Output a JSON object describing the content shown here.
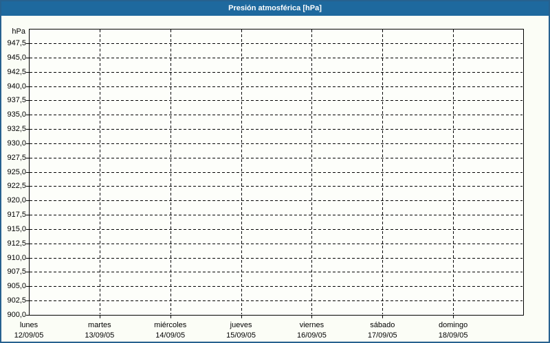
{
  "header": {
    "title": "Presión atmosférica [hPa]"
  },
  "chart_data": {
    "type": "line",
    "title": "Presión atmosférica [hPa]",
    "ylabel": "hPa",
    "ylim": [
      900.0,
      947.5
    ],
    "ytick_step": 2.5,
    "ytick_labels": [
      "947,5",
      "945,0",
      "942,5",
      "940,0",
      "937,5",
      "935,0",
      "932,5",
      "930,0",
      "927,5",
      "925,0",
      "922,5",
      "920,0",
      "917,5",
      "915,0",
      "912,5",
      "910,0",
      "907,5",
      "905,0",
      "902,5",
      "900,0"
    ],
    "x_categories": [
      {
        "day": "lunes",
        "date": "12/09/05"
      },
      {
        "day": "martes",
        "date": "13/09/05"
      },
      {
        "day": "miércoles",
        "date": "14/09/05"
      },
      {
        "day": "jueves",
        "date": "15/09/05"
      },
      {
        "day": "viernes",
        "date": "16/09/05"
      },
      {
        "day": "sábado",
        "date": "17/09/05"
      },
      {
        "day": "domingo",
        "date": "18/09/05"
      }
    ],
    "series": [],
    "grid": "dashed",
    "legend_position": "none"
  },
  "colors": {
    "titlebar": "#1e699e",
    "window_border": "#27618f",
    "background": "#fbfdf6",
    "plot_background": "#fdfefa",
    "grid": "#000000",
    "title_text": "#ffffff",
    "label_text": "#000000"
  }
}
